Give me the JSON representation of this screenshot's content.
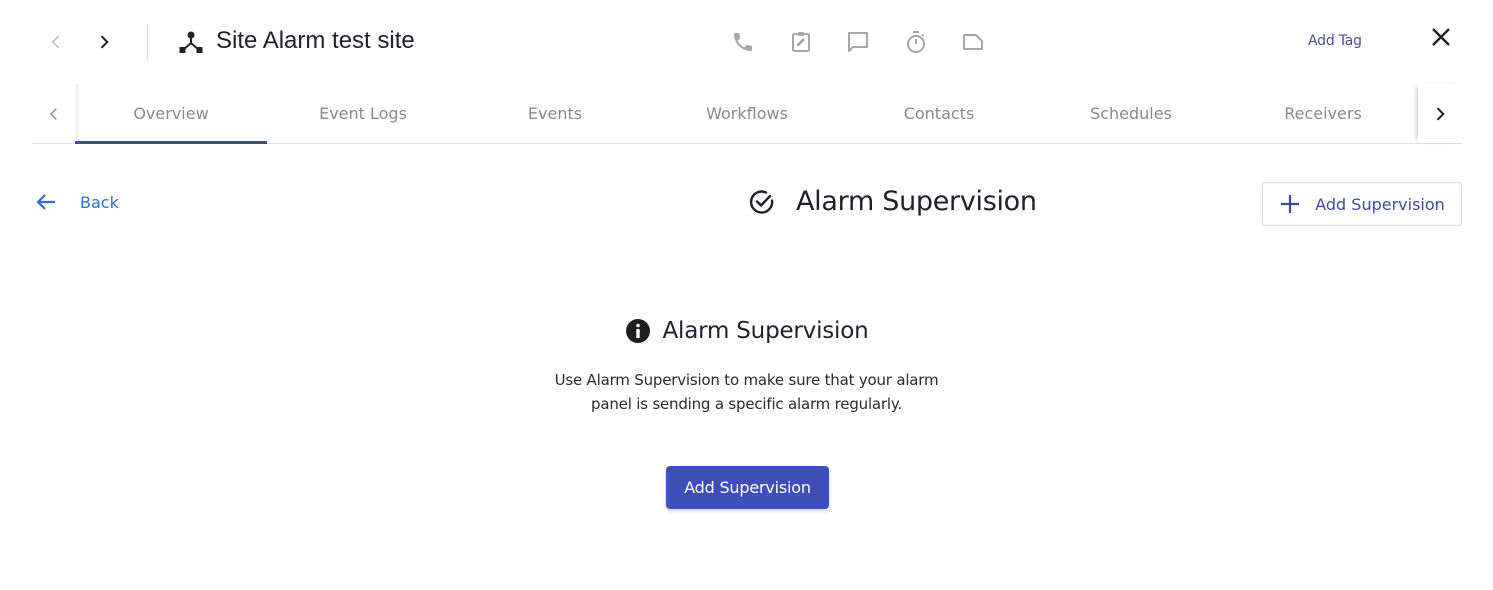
{
  "header": {
    "site_title": "Site Alarm test site",
    "add_tag_label": "Add Tag",
    "actions": [
      {
        "icon": "phone-icon"
      },
      {
        "icon": "clipboard-edit-icon"
      },
      {
        "icon": "comment-icon"
      },
      {
        "icon": "timer-icon"
      },
      {
        "icon": "note-icon"
      }
    ]
  },
  "tabs": [
    {
      "label": "Overview",
      "active": true
    },
    {
      "label": "Event Logs",
      "active": false
    },
    {
      "label": "Events",
      "active": false
    },
    {
      "label": "Workflows",
      "active": false
    },
    {
      "label": "Contacts",
      "active": false
    },
    {
      "label": "Schedules",
      "active": false
    },
    {
      "label": "Receivers",
      "active": false
    }
  ],
  "page": {
    "back_label": "Back",
    "title": "Alarm Supervision",
    "add_button_label": "Add Supervision"
  },
  "empty_state": {
    "heading": "Alarm Supervision",
    "description": "Use Alarm Supervision to make sure that your alarm panel is sending a specific alarm regularly.",
    "button_label": "Add Supervision"
  },
  "colors": {
    "accent": "#3f4fb8",
    "tab_indicator": "#3f4b9a",
    "link_blue": "#2f6fd6"
  }
}
